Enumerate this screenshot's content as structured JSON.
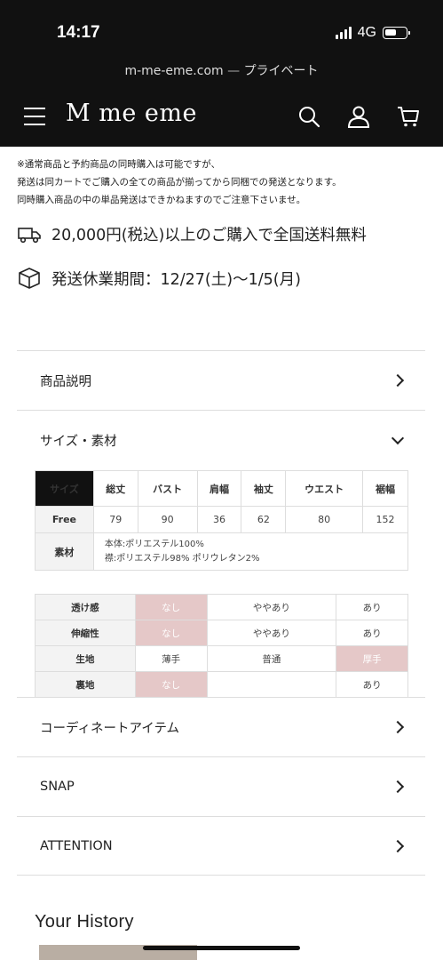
{
  "status_bar": {
    "time": "14:17",
    "network": "4G"
  },
  "browser": {
    "url": "m-me-eme.com",
    "separator": " — ",
    "mode": "プライベート"
  },
  "header": {
    "logo": "M me eme",
    "icons": [
      "menu-icon",
      "search-icon",
      "user-icon",
      "cart-icon"
    ]
  },
  "notice": {
    "line1": "※通常商品と予約商品の同時購入は可能ですが、",
    "line2": "発送は同カートでご購入の全ての商品が揃ってから同梱での発送となります。",
    "line3": "同時購入商品の中の単品発送はできかねますのでご注意下さいませ。"
  },
  "shipping": {
    "free": "20,000円(税込)以上のご購入で全国送料無料",
    "holiday": "発送休業期間：12/27(土)〜1/5(月)"
  },
  "accordion": {
    "description": "商品説明",
    "size_material": "サイズ・素材",
    "coordinate": "コーディネートアイテム",
    "snap": "SNAP",
    "attention": "ATTENTION"
  },
  "size_table": {
    "headers": [
      "サイズ",
      "総丈",
      "バスト",
      "肩幅",
      "袖丈",
      "ウエスト",
      "裾幅"
    ],
    "row": [
      "Free",
      "79",
      "90",
      "36",
      "62",
      "80",
      "152"
    ],
    "material_label": "素材",
    "material_line1": "本体:ポリエステル100%",
    "material_line2": "襟:ポリエステル98% ポリウレタン2%"
  },
  "feel_table": {
    "rows": [
      {
        "label": "透け感",
        "cells": [
          "なし",
          "ややあり",
          "あり"
        ]
      },
      {
        "label": "伸縮性",
        "cells": [
          "なし",
          "ややあり",
          "あり"
        ]
      },
      {
        "label": "生地",
        "cells": [
          "薄手",
          "普通",
          "厚手"
        ]
      },
      {
        "label": "裏地",
        "cells": [
          "なし",
          "",
          "あり"
        ]
      }
    ],
    "highlight_color": "#e5c8c8"
  },
  "history": {
    "title": "Your History"
  }
}
